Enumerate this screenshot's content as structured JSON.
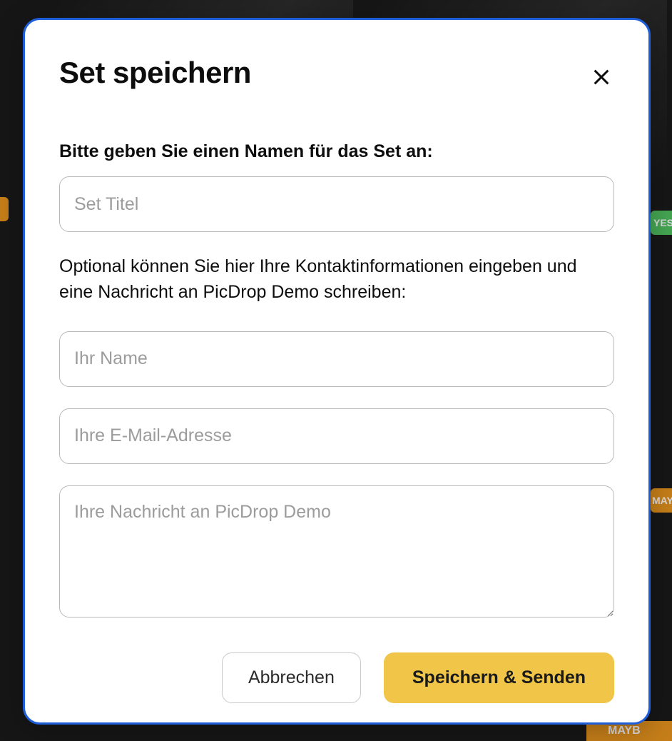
{
  "modal": {
    "title": "Set speichern",
    "label_name": "Bitte geben Sie einen Namen für das Set an:",
    "label_optional": "Optional können Sie hier Ihre Kontaktinformationen eingeben und eine Nachricht an PicDrop Demo schreiben:",
    "placeholders": {
      "set_title": "Set Titel",
      "your_name": "Ihr Name",
      "your_email": "Ihre E-Mail-Adresse",
      "your_message": "Ihre Nachricht an PicDrop Demo"
    },
    "buttons": {
      "cancel": "Abbrechen",
      "save_send": "Speichern & Senden"
    }
  },
  "backdrop": {
    "badge_yes": "YES",
    "badge_maybe": "MAYB"
  }
}
